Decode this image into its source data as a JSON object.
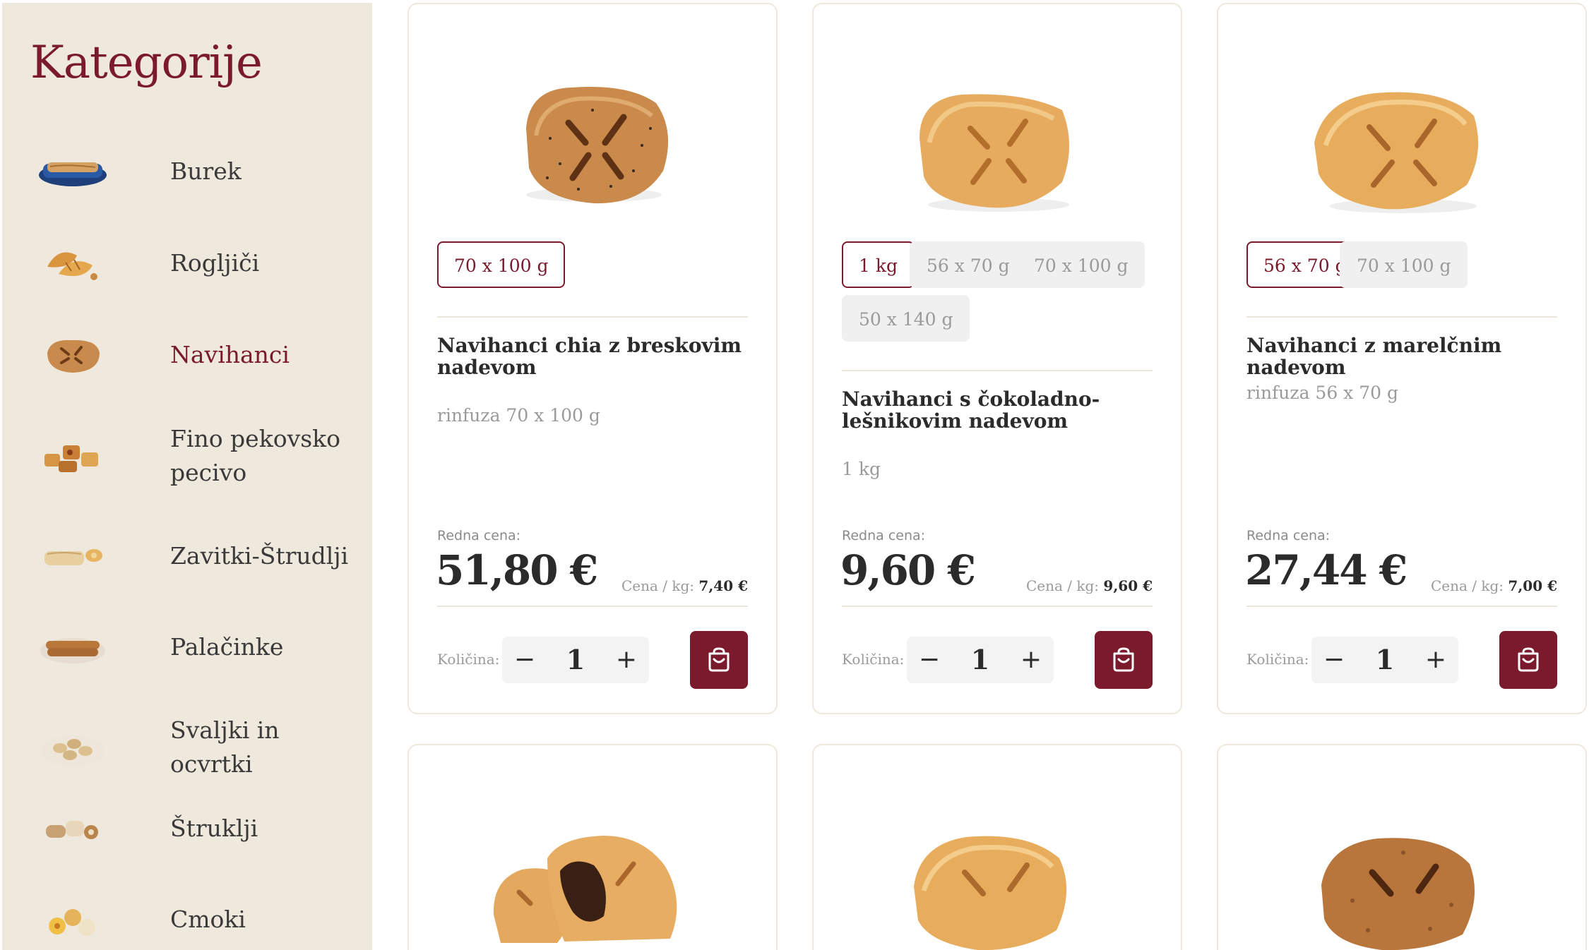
{
  "sidebar": {
    "title": "Kategorije",
    "items": [
      {
        "label": "Burek",
        "icon": "burek-tray-icon",
        "active": false
      },
      {
        "label": "Rogljiči",
        "icon": "croissant-icon",
        "active": false
      },
      {
        "label": "Navihanci",
        "icon": "pastry-square-icon",
        "active": true
      },
      {
        "label": "Fino pekovsko pecivo",
        "icon": "fine-pastry-icon",
        "active": false
      },
      {
        "label": "Zavitki-Štrudlji",
        "icon": "strudel-icon",
        "active": false
      },
      {
        "label": "Palačinke",
        "icon": "crepe-icon",
        "active": false
      },
      {
        "label": "Svaljki in ocvrtki",
        "icon": "fried-dough-icon",
        "active": false
      },
      {
        "label": "Štruklji",
        "icon": "struklji-icon",
        "active": false
      },
      {
        "label": "Cmoki",
        "icon": "dumpling-icon",
        "active": false
      }
    ]
  },
  "common": {
    "price_label": "Redna cena:",
    "per_kg_label": "Cena / kg:",
    "qty_label": "Količina:",
    "minus": "−",
    "plus": "+"
  },
  "products": [
    {
      "title": "Navihanci chia z breskovim nadevom",
      "sizes": [
        "70 x 100 g"
      ],
      "selected_size": "70 x 100 g",
      "subtitle": "rinfuza 70 x 100 g",
      "price": "51,80 €",
      "per_kg": "7,40 €",
      "quantity": "1"
    },
    {
      "title": "Navihanci s čokoladno-lešnikovim nadevom",
      "sizes": [
        "1 kg",
        "56 x 70 g",
        "70 x 100 g",
        "50 x 140 g"
      ],
      "selected_size": "1 kg",
      "subtitle": "1 kg",
      "price": "9,60 €",
      "per_kg": "9,60 €",
      "quantity": "1"
    },
    {
      "title": "Navihanci z marelčnim nadevom",
      "sizes": [
        "56 x 70 g",
        "70 x 100 g"
      ],
      "selected_size": "56 x 70 g",
      "subtitle": "rinfuza 56 x 70 g",
      "price": "27,44 €",
      "per_kg": "7,00 €",
      "quantity": "1"
    }
  ],
  "colors": {
    "brand": "#7a1a2c",
    "sidebar_bg": "#efe8dc",
    "pastry_light": "#e6ab5f",
    "pastry_dark": "#b9773a"
  }
}
